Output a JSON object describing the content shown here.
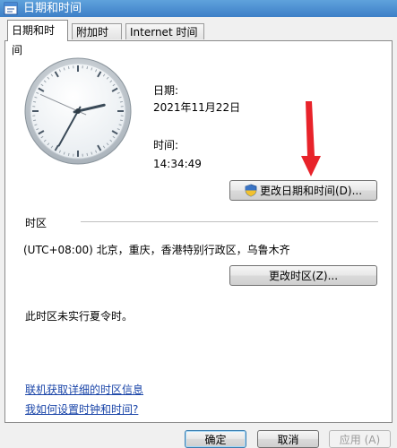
{
  "window": {
    "title": "日期和时间"
  },
  "tabs": [
    {
      "label": "日期和时间",
      "active": true
    },
    {
      "label": "附加时钟",
      "active": false
    },
    {
      "label": "Internet 时间",
      "active": false
    }
  ],
  "clock": {
    "hour": 14,
    "minute": 34,
    "second": 49
  },
  "date_section": {
    "label": "日期:",
    "value": "2021年11月22日"
  },
  "time_section": {
    "label": "时间:",
    "value": "14:34:49"
  },
  "buttons": {
    "change_datetime": "更改日期和时间(D)...",
    "change_timezone": "更改时区(Z)...",
    "ok": "确定",
    "cancel": "取消",
    "apply": "应用 (A)"
  },
  "timezone": {
    "heading": "时区",
    "value": "(UTC+08:00) 北京，重庆，香港特别行政区，乌鲁木齐",
    "dst_note": "此时区未实行夏令时。"
  },
  "links": {
    "online_info": "联机获取详细的时区信息",
    "how_to_set": "我如何设置时钟和时间?"
  },
  "colors": {
    "annotation_arrow": "#e8232a",
    "link": "#1a45a8",
    "accent": "#3d7fc7"
  }
}
